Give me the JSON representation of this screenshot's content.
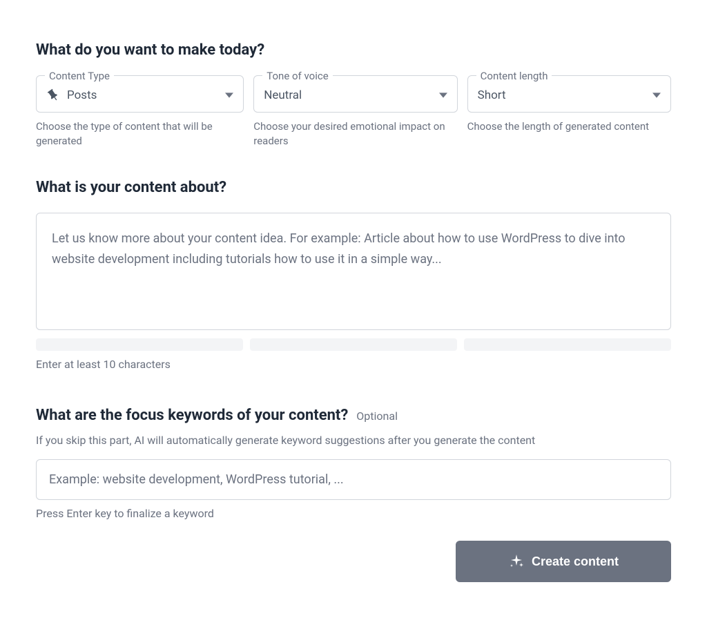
{
  "headings": {
    "make_today": "What do you want to make today?",
    "content_about": "What is your content about?",
    "focus_keywords": "What are the focus keywords of your content?",
    "optional": "Optional"
  },
  "fields": {
    "content_type": {
      "legend": "Content Type",
      "value": "Posts",
      "helper": "Choose the type of content that will be generated"
    },
    "tone": {
      "legend": "Tone of voice",
      "value": "Neutral",
      "helper": "Choose your desired emotional impact on readers"
    },
    "length": {
      "legend": "Content length",
      "value": "Short",
      "helper": "Choose the length of generated content"
    }
  },
  "content_about": {
    "placeholder": "Let us know more about your content idea. For example: Article about how to use WordPress to dive into website development including tutorials how to use it in a simple way...",
    "hint": "Enter at least 10 characters"
  },
  "keywords": {
    "subtext": "If you skip this part, AI will automatically generate keyword suggestions after you generate the content",
    "placeholder": "Example: website development, WordPress tutorial, ...",
    "hint": "Press Enter key to finalize a keyword"
  },
  "button": {
    "create": "Create content"
  }
}
